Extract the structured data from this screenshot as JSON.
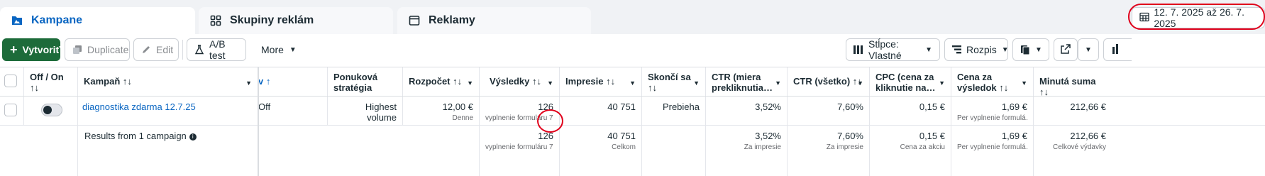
{
  "tabs": [
    {
      "label": "Kampane",
      "icon": "folder-icon",
      "active": true
    },
    {
      "label": "Skupiny reklám",
      "icon": "grid-icon",
      "active": false
    },
    {
      "label": "Reklamy",
      "icon": "ad-icon",
      "active": false
    }
  ],
  "date_range": {
    "label": "12. 7. 2025 až 26. 7. 2025",
    "icon": "calendar-icon"
  },
  "toolbar": {
    "create_label": "Vytvoriť",
    "duplicate_label": "Duplicate",
    "edit_label": "Edit",
    "ab_test_label": "A/B test",
    "more_label": "More",
    "columns_label": "Stĺpce: Vlastné",
    "breakdown_label": "Rozpis"
  },
  "columns": {
    "off_on": "Off / On",
    "off_on_sort": "↑↓",
    "campaign": "Kampaň ↑↓",
    "delivery_fragment": "v ↑",
    "bid_strategy_1": "Ponuková",
    "bid_strategy_2": "stratégia",
    "budget": "Rozpočet ↑↓",
    "results": "Výsledky ↑↓",
    "impressions": "Impresie ↑↓",
    "ends": "Skončí sa",
    "ends_sort": "↑↓",
    "ctr_link_1": "CTR (miera",
    "ctr_link_2": "prekliknutia…",
    "ctr_all": "CTR (všetko) ↑↓",
    "cpc_1": "CPC (cena za",
    "cpc_2": "kliknutie na…",
    "cost_result_1": "Cena za",
    "cost_result_2": "výsledok ↑↓",
    "spent": "Minutá suma ↑↓"
  },
  "rows": [
    {
      "campaign": "diagnostika zdarma 12.7.25",
      "delivery_fragment": "Off",
      "bid_strategy": "Highest volume",
      "budget": "12,00 €",
      "budget_sub": "Denne",
      "results": "126",
      "results_sub": "vyplnenie formuláru 7…",
      "impressions": "40 751",
      "ends": "Prebieha",
      "ctr_link": "3,52%",
      "ctr_all": "7,60%",
      "cpc": "0,15 €",
      "cost_result": "1,69 €",
      "cost_result_sub": "Per vyplnenie formulá…",
      "spent": "212,66 €"
    }
  ],
  "summary": {
    "label": "Results from 1 campaign",
    "results": "126",
    "results_sub": "vyplnenie formuláru 7…",
    "impressions": "40 751",
    "impressions_sub": "Celkom",
    "ctr_link": "3,52%",
    "ctr_link_sub": "Za impresie",
    "ctr_all": "7,60%",
    "ctr_all_sub": "Za impresie",
    "cpc": "0,15 €",
    "cpc_sub": "Cena za akciu",
    "cost_result": "1,69 €",
    "cost_result_sub": "Per vyplnenie formulá…",
    "spent": "212,66 €",
    "spent_sub": "Celkové výdavky"
  },
  "colors": {
    "accent": "#0a66c2",
    "primary_button": "#1d6b3a",
    "annotation": "#e0001b"
  }
}
